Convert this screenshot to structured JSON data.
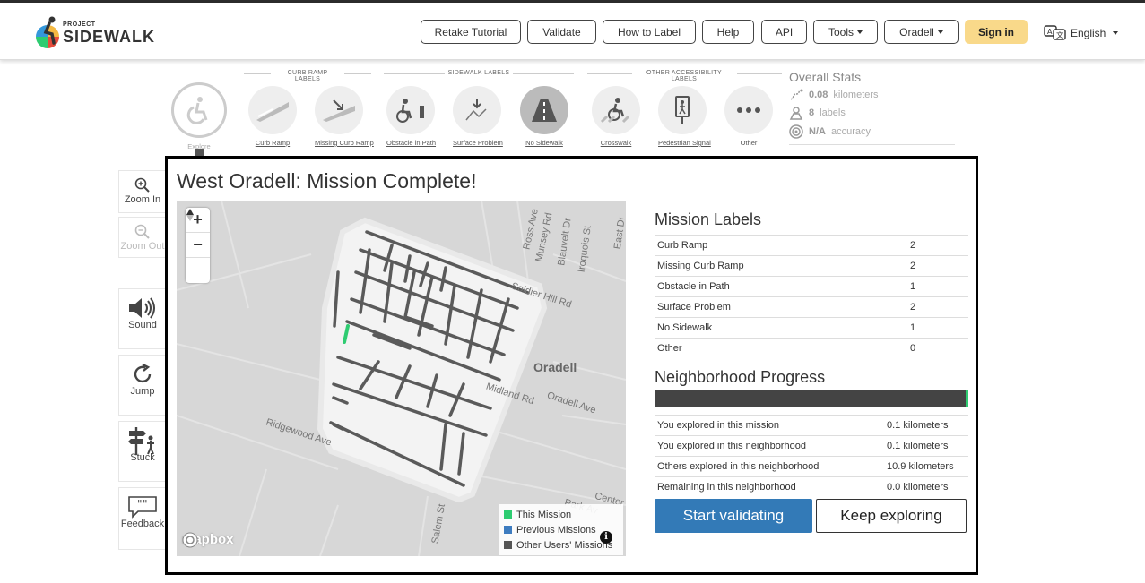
{
  "nav": {
    "logo_small": "PROJECT",
    "logo_big": "SIDEWALK",
    "buttons": [
      {
        "label": "Retake Tutorial"
      },
      {
        "label": "Validate"
      },
      {
        "label": "How to Label"
      },
      {
        "label": "Help"
      },
      {
        "label": "API"
      },
      {
        "label": "Tools"
      },
      {
        "label": "Oradell"
      }
    ],
    "signin": "Sign in",
    "language": "English"
  },
  "toolbar": {
    "groups": {
      "curb": "CURB RAMP LABELS",
      "sidewalk": "SIDEWALK LABELS",
      "other": "OTHER ACCESSIBILITY LABELS"
    },
    "tools": [
      {
        "label": "Explore"
      },
      {
        "label": "Curb Ramp"
      },
      {
        "label": "Missing Curb Ramp"
      },
      {
        "label": "Obstacle in Path"
      },
      {
        "label": "Surface Problem"
      },
      {
        "label": "No Sidewalk"
      },
      {
        "label": "Crosswalk"
      },
      {
        "label": "Pedestrian Signal"
      },
      {
        "label": "Other"
      }
    ]
  },
  "stats": {
    "title": "Overall Stats",
    "distance_value": "0.08",
    "distance_unit": "kilometers",
    "labels_value": "8",
    "labels_unit": "labels",
    "accuracy_value": "N/A",
    "accuracy_unit": "accuracy"
  },
  "side": {
    "zoom_in": "Zoom In",
    "zoom_out": "Zoom Out",
    "sound": "Sound",
    "jump": "Jump",
    "stuck": "Stuck",
    "feedback": "Feedback"
  },
  "modal": {
    "title": "West Oradell: Mission Complete!",
    "map": {
      "zoom_in": "+",
      "zoom_out": "−",
      "streets": [
        "Ross Ave",
        "Munsey Rd",
        "Blauvelt Dr",
        "Iroquois St",
        "East Dr",
        "Soldier Hill Rd",
        "Oradell",
        "Oradell Ave",
        "Ridgewood Ave",
        "Park Av",
        "Center",
        "Salem St",
        "Midland Rd"
      ],
      "legend": [
        {
          "label": "This Mission",
          "color": "#2ecc71"
        },
        {
          "label": "Previous Missions",
          "color": "#3e7cc0"
        },
        {
          "label": "Other Users' Missions",
          "color": "#555555"
        }
      ],
      "attribution": "mapbox"
    },
    "mission_labels_title": "Mission Labels",
    "mission_labels": [
      {
        "name": "Curb Ramp",
        "count": "2"
      },
      {
        "name": "Missing Curb Ramp",
        "count": "2"
      },
      {
        "name": "Obstacle in Path",
        "count": "1"
      },
      {
        "name": "Surface Problem",
        "count": "2"
      },
      {
        "name": "No Sidewalk",
        "count": "1"
      },
      {
        "name": "Other",
        "count": "0"
      }
    ],
    "progress_title": "Neighborhood Progress",
    "progress_fraction": 0.01,
    "progress_rows": [
      {
        "name": "You explored in this mission",
        "value": "0.1 kilometers"
      },
      {
        "name": "You explored in this neighborhood",
        "value": "0.1 kilometers"
      },
      {
        "name": "Others explored in this neighborhood",
        "value": "10.9 kilometers"
      },
      {
        "name": "Remaining in this neighborhood",
        "value": "0.0 kilometers"
      }
    ],
    "start_validating": "Start validating",
    "keep_exploring": "Keep exploring"
  }
}
